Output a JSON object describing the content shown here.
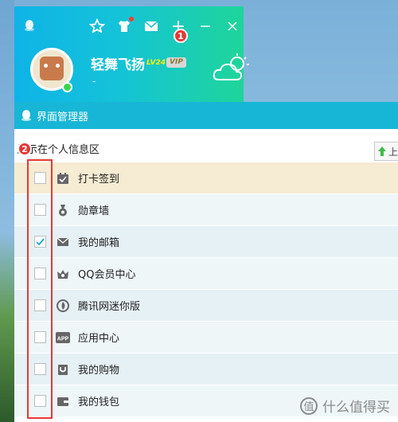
{
  "qq": {
    "nickname": "轻舞飞扬",
    "level_badge": "LV24",
    "vip_badge": "VIP",
    "signature": "-",
    "callout_1": "1",
    "icons": [
      "star-icon",
      "shirt-icon",
      "mail-icon",
      "plus-icon",
      "minimize-icon",
      "close-icon",
      "weather-icon"
    ]
  },
  "manager": {
    "title": "界面管理器",
    "callout_2": "2",
    "section_label": "显示在个人信息区",
    "up_button_label": "上",
    "items": [
      {
        "label": "打卡签到",
        "checked": false,
        "icon": "calendar-icon"
      },
      {
        "label": "勋章墙",
        "checked": false,
        "icon": "medal-icon"
      },
      {
        "label": "我的邮箱",
        "checked": true,
        "icon": "mail-icon"
      },
      {
        "label": "QQ会员中心",
        "checked": false,
        "icon": "crown-icon"
      },
      {
        "label": "腾讯网迷你版",
        "checked": false,
        "icon": "tencent-news-icon"
      },
      {
        "label": "应用中心",
        "checked": false,
        "icon": "app-icon"
      },
      {
        "label": "我的购物",
        "checked": false,
        "icon": "shopping-icon"
      },
      {
        "label": "我的钱包",
        "checked": false,
        "icon": "wallet-icon"
      }
    ]
  },
  "watermark": {
    "text": "什么值得买",
    "logo_char": "值"
  },
  "colors": {
    "header_gradient_start": "#0fb3e7",
    "header_gradient_end": "#1fd59a",
    "manager_title": "#17b6d6",
    "highlight_row": "#f6ecd3",
    "callout_red": "#e53935",
    "check_teal": "#1ea7c9"
  }
}
